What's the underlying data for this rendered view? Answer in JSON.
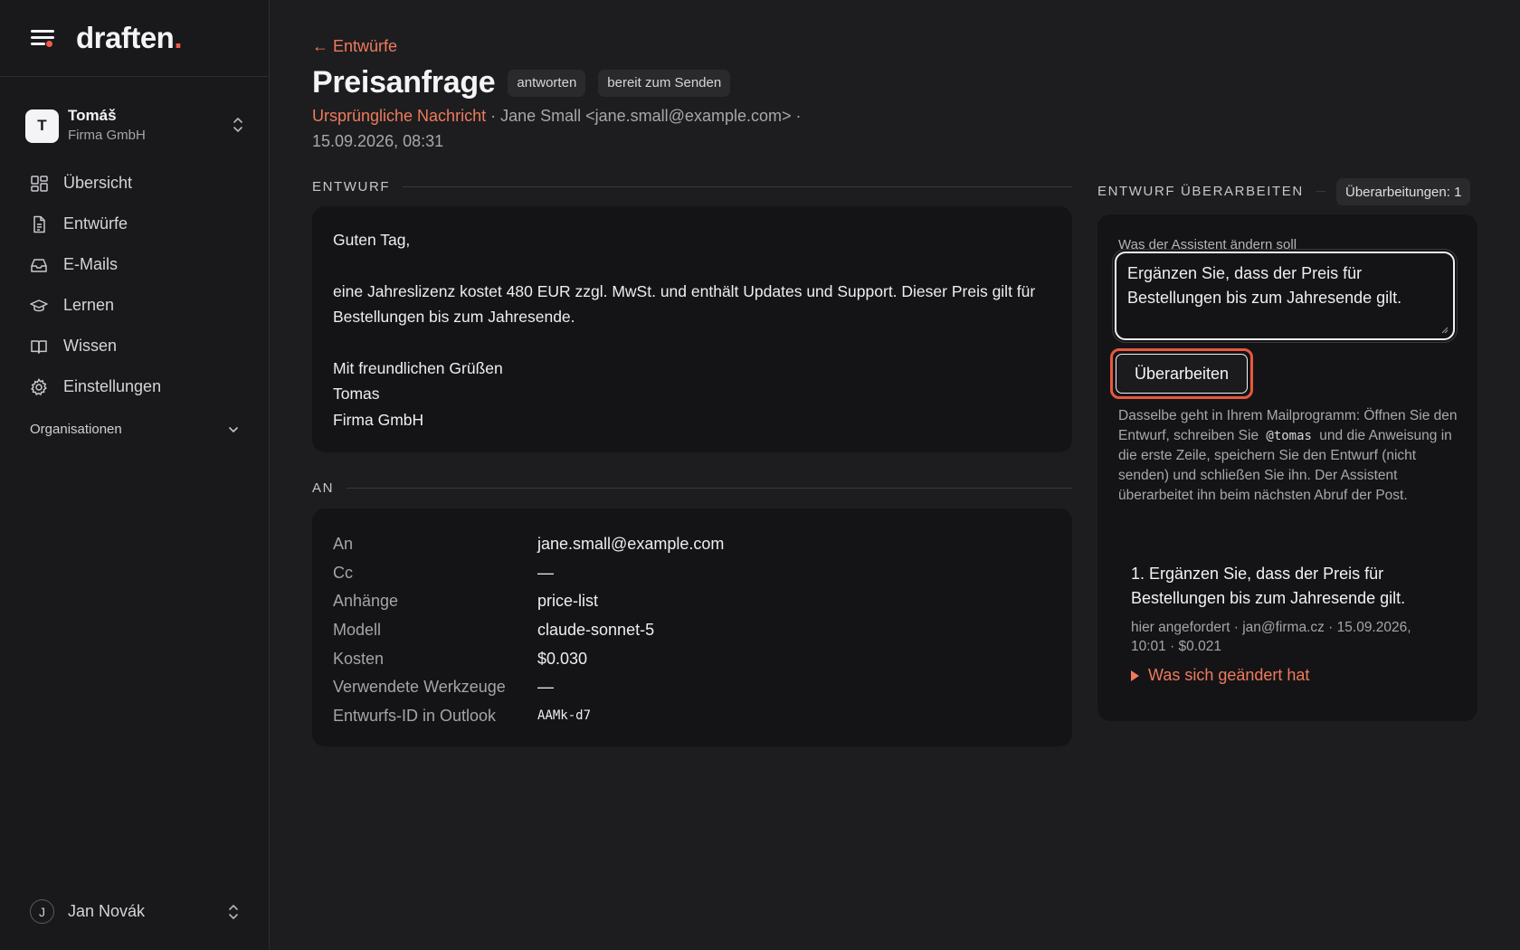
{
  "brand": {
    "name": "draften",
    "dot": "."
  },
  "account": {
    "initial": "T",
    "name": "Tomáš",
    "org": "Firma GmbH"
  },
  "nav": {
    "items": [
      {
        "label": "Übersicht",
        "icon": "grid-icon"
      },
      {
        "label": "Entwürfe",
        "icon": "document-icon"
      },
      {
        "label": "E-Mails",
        "icon": "inbox-icon"
      },
      {
        "label": "Lernen",
        "icon": "graduation-cap-icon"
      },
      {
        "label": "Wissen",
        "icon": "book-icon"
      },
      {
        "label": "Einstellungen",
        "icon": "gear-icon"
      }
    ],
    "organisations_label": "Organisationen"
  },
  "user": {
    "initial": "J",
    "name": "Jan Novák"
  },
  "header": {
    "back_label": "← Entwürfe",
    "title": "Preisanfrage",
    "chips": [
      "antworten",
      "bereit zum Senden"
    ],
    "original_link": "Ursprüngliche Nachricht",
    "meta_sender": " · Jane Small <jane.small@example.com> · ",
    "meta_date": "15.09.2026, 08:31"
  },
  "draft": {
    "section_label": "ENTWURF",
    "lines": [
      "Guten Tag,",
      "",
      "eine Jahreslizenz kostet 480 EUR zzgl. MwSt. und enthält Updates und Support. Dieser Preis gilt für Bestellungen bis zum Jahresende.",
      "",
      "Mit freundlichen Grüßen",
      "Tomas",
      "Firma GmbH"
    ]
  },
  "recipients": {
    "section_label": "AN",
    "rows": [
      {
        "key": "An",
        "value": "jane.small@example.com"
      },
      {
        "key": "Cc",
        "value": "—"
      },
      {
        "key": "Anhänge",
        "value": "price-list"
      },
      {
        "key": "Modell",
        "value": "claude-sonnet-5"
      },
      {
        "key": "Kosten",
        "value": "$0.030"
      },
      {
        "key": "Verwendete Werkzeuge",
        "value": "—"
      },
      {
        "key": "Entwurfs-ID in Outlook",
        "value": "AAMk-d7"
      }
    ]
  },
  "revise": {
    "section_label": "ENTWURF ÜBERARBEITEN",
    "count_label": "Überarbeitungen: 1",
    "field_label": "Was der Assistent ändern soll",
    "field_value": "Ergänzen Sie, dass der Preis für Bestellungen bis zum Jahresende gilt.",
    "button_label": "Überarbeiten",
    "help_before": "Dasselbe geht in Ihrem Mailprogramm: Öffnen Sie den Entwurf, schreiben Sie",
    "help_code": "@tomas",
    "help_after": "und die Anweisung in die erste Zeile, speichern Sie den Entwurf (nicht senden) und schließen Sie ihn. Der Assistent überarbeitet ihn beim nächsten Abruf der Post.",
    "history": [
      {
        "title": "1. Ergänzen Sie, dass der Preis für Bestellungen bis zum Jahresende gilt.",
        "meta": "hier angefordert · jan@firma.cz · 15.09.2026, 10:01 · $0.021",
        "toggle": "Was sich geändert hat"
      }
    ]
  },
  "colors": {
    "accent": "#ef7a5c",
    "focus_ring": "#e9573f",
    "background": "#1d1d1f",
    "card": "#141416"
  }
}
